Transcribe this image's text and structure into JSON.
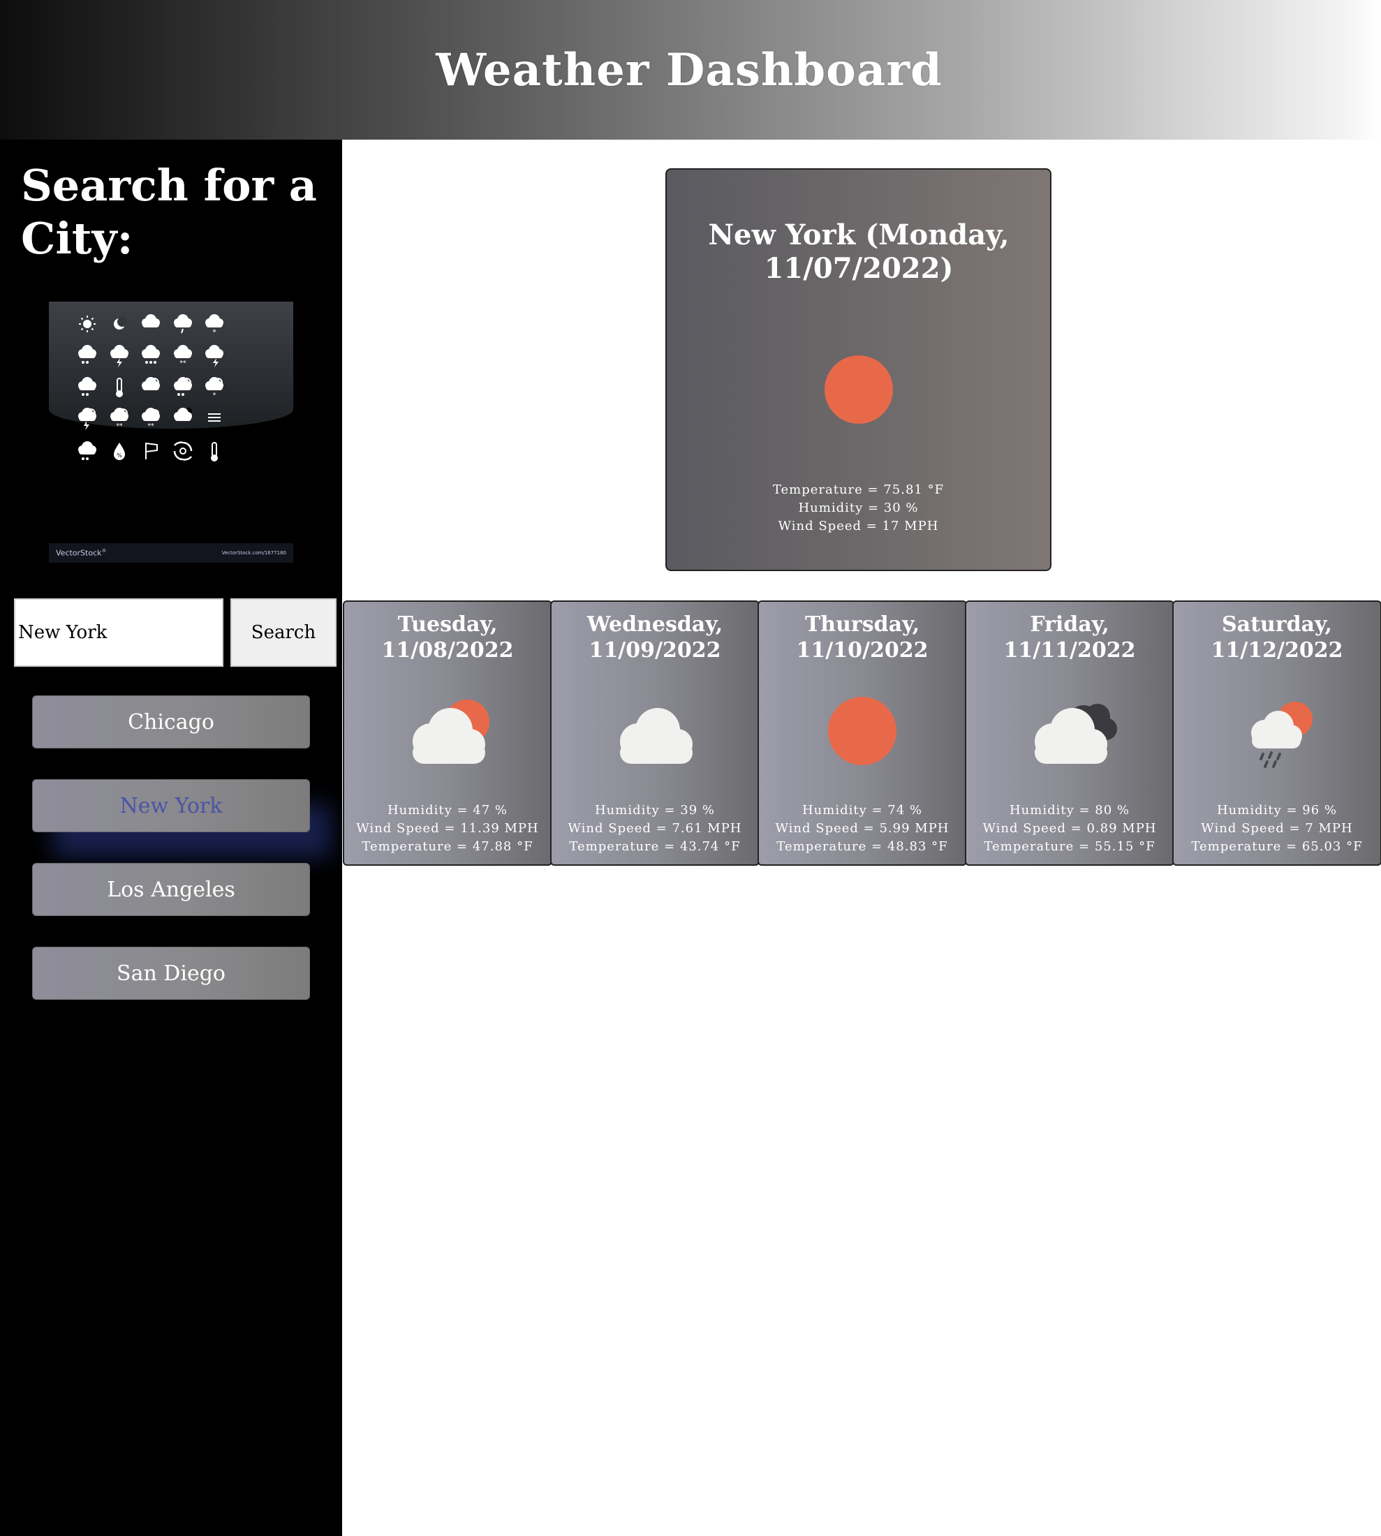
{
  "header": {
    "title": "Weather Dashboard"
  },
  "sidebar": {
    "title": "Search for a City:",
    "image": {
      "icons_row1": [
        "sun-icon",
        "moon-icon",
        "cloud-icon",
        "cloud-drizzle-icon",
        "cloud-snow-icon"
      ],
      "icons_row2": [
        "cloud-rain-icon",
        "cloud-lightning-icon",
        "cloud-heavy-rain-icon",
        "cloud-sleet-icon",
        "cloud-storm-icon"
      ],
      "icons_row3": [
        "cloud-hail-icon",
        "thermometer-icon",
        "sun-cloud-icon",
        "sun-cloud-rain-icon",
        "sun-cloud-snow-icon"
      ],
      "icons_row4": [
        "sun-cloud-lightning-icon",
        "sun-cloud-hail-icon",
        "moon-cloud-snow-icon",
        "moon-cloud-icon",
        "fog-icon"
      ],
      "icons_row5": [
        "cloud-hail-icon",
        "humidity-drop-icon",
        "wind-flag-icon",
        "hurricane-icon",
        "thermometer-icon"
      ],
      "brand": "VectorStock",
      "brand_mark": "®",
      "url": "VectorStock.com/1677180"
    },
    "search": {
      "value": "New York",
      "button_label": "Search"
    },
    "cities": [
      "Chicago",
      "New York",
      "Los Angeles",
      "San Diego"
    ],
    "active_city": "New York"
  },
  "today": {
    "title": "New York (Monday, 11/07/2022)",
    "icon": "sun-icon",
    "temperature": "Temperature = 75.81 °F",
    "humidity": "Humidity = 30 %",
    "wind": "Wind Speed = 17 MPH"
  },
  "forecast": [
    {
      "date": "Tuesday, 11/08/2022",
      "icon": "sun-behind-cloud-icon",
      "humidity": "Humidity = 47 %",
      "wind": "Wind Speed = 11.39 MPH",
      "temperature": "Temperature = 47.88 °F"
    },
    {
      "date": "Wednesday, 11/09/2022",
      "icon": "cloud-icon",
      "humidity": "Humidity = 39 %",
      "wind": "Wind Speed = 7.61 MPH",
      "temperature": "Temperature = 43.74 °F"
    },
    {
      "date": "Thursday, 11/10/2022",
      "icon": "sun-icon",
      "humidity": "Humidity = 74 %",
      "wind": "Wind Speed = 5.99 MPH",
      "temperature": "Temperature = 48.83 °F"
    },
    {
      "date": "Friday, 11/11/2022",
      "icon": "broken-clouds-icon",
      "humidity": "Humidity = 80 %",
      "wind": "Wind Speed = 0.89 MPH",
      "temperature": "Temperature = 55.15 °F"
    },
    {
      "date": "Saturday, 11/12/2022",
      "icon": "sun-cloud-rain-icon",
      "humidity": "Humidity = 96 %",
      "wind": "Wind Speed = 7 MPH",
      "temperature": "Temperature = 65.03 °F"
    }
  ],
  "colors": {
    "sun": "#e8694a",
    "cloud": "#f1f1ef",
    "dark_cloud": "#3b3b3f",
    "rain": "#4a4a52",
    "active_city_text": "#4a54a6"
  }
}
